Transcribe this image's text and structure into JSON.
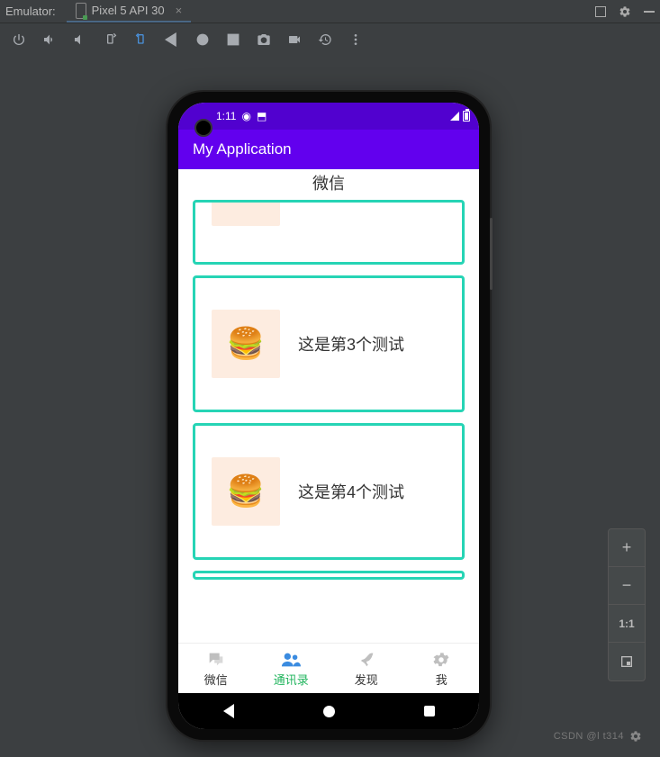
{
  "ide": {
    "emulator_label": "Emulator:",
    "device_tab": "Pixel 5 API 30"
  },
  "zoom": {
    "in": "+",
    "out": "−",
    "fit": "1:1"
  },
  "phone": {
    "status": {
      "time": "1:11"
    },
    "appbar_title": "My Application",
    "page_title": "微信",
    "cards": [
      {
        "text": ""
      },
      {
        "text": "这是第3个测试"
      },
      {
        "text": "这是第4个测试"
      }
    ],
    "tabs": [
      {
        "label": "微信"
      },
      {
        "label": "通讯录"
      },
      {
        "label": "发现"
      },
      {
        "label": "我"
      }
    ],
    "active_tab": 1
  },
  "watermark": "CSDN @l t314"
}
